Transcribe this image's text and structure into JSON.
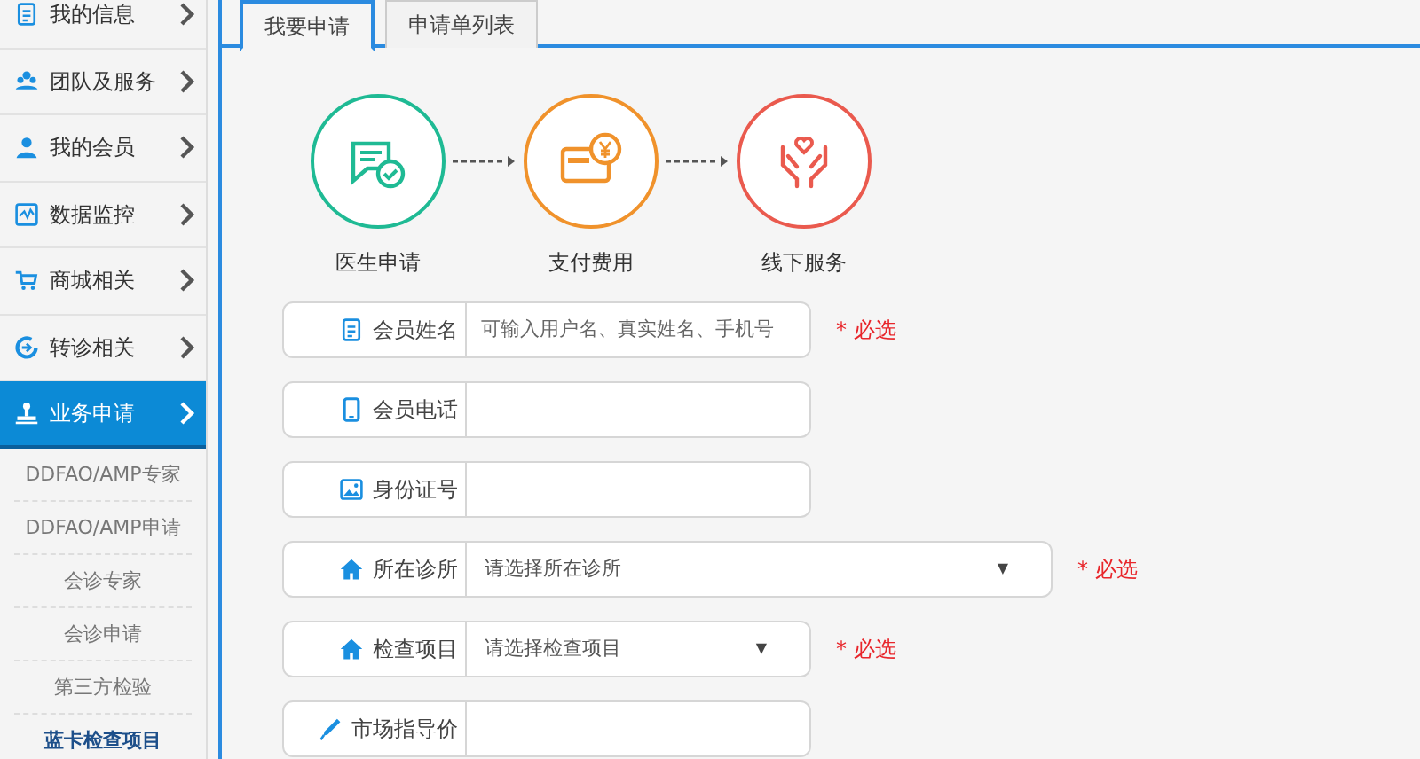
{
  "sidebar": {
    "items": [
      {
        "label": "我的信息",
        "selected": false
      },
      {
        "label": "团队及服务",
        "selected": false
      },
      {
        "label": "我的会员",
        "selected": false
      },
      {
        "label": "数据监控",
        "selected": false
      },
      {
        "label": "商城相关",
        "selected": false
      },
      {
        "label": "转诊相关",
        "selected": false
      },
      {
        "label": "业务申请",
        "selected": true,
        "children": [
          {
            "label": "DDFAO/AMP专家",
            "selected": false
          },
          {
            "label": "DDFAO/AMP申请",
            "selected": false
          },
          {
            "label": "会诊专家",
            "selected": false
          },
          {
            "label": "会诊申请",
            "selected": false
          },
          {
            "label": "第三方检验",
            "selected": false
          },
          {
            "label": "蓝卡检查项目",
            "selected": true
          }
        ]
      }
    ]
  },
  "tabs": [
    {
      "label": "我要申请",
      "selected": true
    },
    {
      "label": "申请单列表",
      "selected": false
    }
  ],
  "steps": [
    {
      "label": "医生申请",
      "kind": "apply",
      "color": "#1fba94"
    },
    {
      "label": "支付费用",
      "kind": "pay",
      "color": "#f0922b"
    },
    {
      "label": "线下服务",
      "kind": "service",
      "color": "#ea5a4e"
    }
  ],
  "form": {
    "fields": [
      {
        "label": "会员姓名",
        "kind": "text",
        "placeholder": "可输入用户名、真实姓名、手机号",
        "note": "* 必选"
      },
      {
        "label": "会员电话",
        "kind": "text"
      },
      {
        "label": "身份证号",
        "kind": "text"
      },
      {
        "label": "所在诊所",
        "kind": "wideselect",
        "value": "请选择所在诊所",
        "caret": "▼",
        "note": "* 必选"
      },
      {
        "label": "检查项目",
        "kind": "select",
        "value": "请选择检查项目",
        "caret": "▼",
        "note": "* 必选"
      },
      {
        "label": "市场指导价",
        "kind": "text"
      }
    ]
  }
}
